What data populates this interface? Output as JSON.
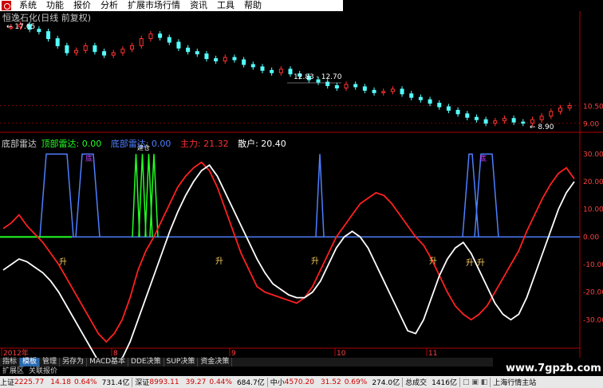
{
  "menu": [
    "系统",
    "功能",
    "报价",
    "分析",
    "扩展市场行情",
    "资讯",
    "工具",
    "帮助"
  ],
  "stock": {
    "title": "恒逸石化(日线 前复权)",
    "high_label": "17.65",
    "low_label": "8.90",
    "range_label": "12.83 - 12.70"
  },
  "price_axis": [
    "10.50",
    "9.00"
  ],
  "indicator": {
    "name": "底部雷达",
    "top_label": "顶部雷达: 0.00",
    "bottom_label": "底部雷达: 0.00",
    "main_label": "主力: 21.32",
    "retail_label": "散户: 20.40",
    "axis": [
      "30.00",
      "20.00",
      "10.00",
      "0.00",
      "-10.00",
      "-20.00",
      "-30.00"
    ],
    "marks": {
      "sheng": "升",
      "di": "底",
      "cb": "建仓"
    }
  },
  "time_axis": [
    "2012年",
    "8",
    "9",
    "10",
    "11"
  ],
  "toolbar": [
    "指标",
    "模板",
    "管理",
    "另存为",
    "MACD基本",
    "DDE决策",
    "SUP决策",
    "资金决策"
  ],
  "subbar": [
    "扩展区",
    "关联报价"
  ],
  "status": {
    "sh_label": "上证",
    "sh_value": "2225.77",
    "sh_change": "14.18",
    "sh_pct": "0.64%",
    "sh_amount": "731.4亿",
    "sz_label": "深证",
    "sz_value": "8993.11",
    "sz_change": "39.27",
    "sz_pct": "0.44%",
    "sz_amount": "684.7亿",
    "zx_label": "中小",
    "zx_value": "4570.20",
    "zx_change": "31.52",
    "zx_pct": "0.69%",
    "zx_amount": "274.0亿",
    "deal_label": "总成交",
    "deal_value": "1416亿",
    "server": "上海行情主站"
  },
  "watermark": "www.7gpzb.com",
  "colors": {
    "up": "#ff3333",
    "down": "#54ffff",
    "main": "#ff2020",
    "retail": "#ffffff",
    "radar": "#4d7fff",
    "top": "#22ff22"
  },
  "chart_data": [
    {
      "type": "candlestick",
      "title": "恒逸石化(日线 前复权)",
      "xlabel": "",
      "ylabel": "",
      "x": [
        "2012年",
        "8",
        "9",
        "10",
        "11"
      ],
      "ylim": [
        8.5,
        18
      ],
      "annotations": [
        "17.65",
        "8.90",
        "12.83 - 12.70"
      ],
      "series": [
        {
          "name": "",
          "values": [
            17.2,
            17.4,
            17.0,
            16.8,
            16.2,
            15.6,
            15.0,
            15.2,
            15.6,
            15.1,
            14.8,
            15.0,
            15.3,
            15.6,
            16.2,
            16.6,
            16.3,
            15.9,
            15.4,
            15.1,
            14.9,
            14.5,
            14.3,
            14.6,
            14.4,
            14.0,
            13.8,
            13.5,
            13.3,
            13.6,
            13.2,
            13.0,
            12.7,
            12.5,
            12.2,
            12.0,
            12.3,
            12.1,
            11.8,
            11.6,
            11.7,
            11.9,
            11.5,
            11.2,
            11.0,
            10.7,
            10.4,
            10.1,
            9.8,
            9.5,
            9.3,
            9.0,
            9.2,
            9.4,
            9.1,
            9.0,
            9.3,
            9.6,
            10.0,
            10.3,
            10.5
          ]
        }
      ]
    },
    {
      "type": "line",
      "title": "底部雷达",
      "ylim": [
        -40,
        35
      ],
      "series": [
        {
          "name": "主力",
          "values": [
            3,
            5,
            8,
            4,
            1,
            -2,
            -6,
            -10,
            -15,
            -20,
            -25,
            -30,
            -35,
            -38,
            -35,
            -30,
            -22,
            -12,
            -5,
            0,
            6,
            12,
            18,
            22,
            25,
            27,
            24,
            18,
            10,
            2,
            -6,
            -12,
            -18,
            -20,
            -21,
            -22,
            -23,
            -24,
            -22,
            -18,
            -12,
            -6,
            0,
            4,
            8,
            12,
            14,
            16,
            15,
            12,
            8,
            4,
            0,
            -3,
            -8,
            -14,
            -20,
            -25,
            -28,
            -30,
            -28,
            -25,
            -20,
            -15,
            -10,
            -5,
            2,
            8,
            14,
            19,
            23,
            25,
            21
          ]
        },
        {
          "name": "散户",
          "values": [
            -12,
            -10,
            -8,
            -9,
            -11,
            -13,
            -16,
            -20,
            -25,
            -30,
            -35,
            -40,
            -45,
            -50,
            -48,
            -44,
            -38,
            -30,
            -22,
            -14,
            -6,
            2,
            9,
            15,
            20,
            24,
            26,
            22,
            16,
            10,
            4,
            -2,
            -8,
            -13,
            -17,
            -19,
            -21,
            -22,
            -22,
            -20,
            -16,
            -10,
            -4,
            0,
            2,
            0,
            -4,
            -10,
            -16,
            -22,
            -28,
            -34,
            -35,
            -30,
            -22,
            -14,
            -8,
            -4,
            -2,
            -6,
            -12,
            -18,
            -24,
            -28,
            -30,
            -28,
            -22,
            -14,
            -6,
            2,
            10,
            16,
            20
          ]
        }
      ]
    }
  ]
}
